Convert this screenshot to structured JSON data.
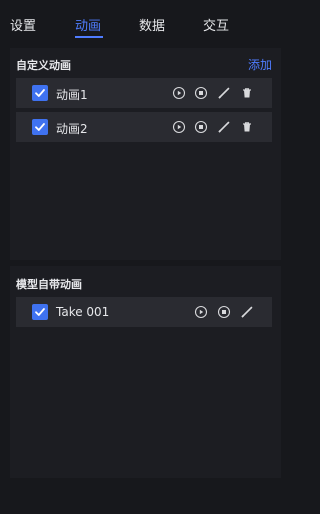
{
  "tabs": [
    {
      "label": "设置",
      "active": false
    },
    {
      "label": "动画",
      "active": true
    },
    {
      "label": "数据",
      "active": false
    },
    {
      "label": "交互",
      "active": false
    }
  ],
  "custom_animations": {
    "title": "自定义动画",
    "add_label": "添加",
    "items": [
      {
        "label": "动画1",
        "checked": true,
        "actions": [
          "play-icon",
          "stop-icon",
          "edit-icon",
          "delete-icon"
        ]
      },
      {
        "label": "动画2",
        "checked": true,
        "actions": [
          "play-icon",
          "stop-icon",
          "edit-icon",
          "delete-icon"
        ]
      }
    ]
  },
  "builtin_animations": {
    "title": "模型自带动画",
    "items": [
      {
        "label": "Take 001",
        "checked": true,
        "actions": [
          "play-icon",
          "stop-icon",
          "edit-icon"
        ]
      }
    ]
  },
  "colors": {
    "accent": "#4f7cff",
    "checkbox": "#3f72f0",
    "background": "#17181c",
    "panel": "#1c1d22",
    "row": "#2a2b31"
  }
}
